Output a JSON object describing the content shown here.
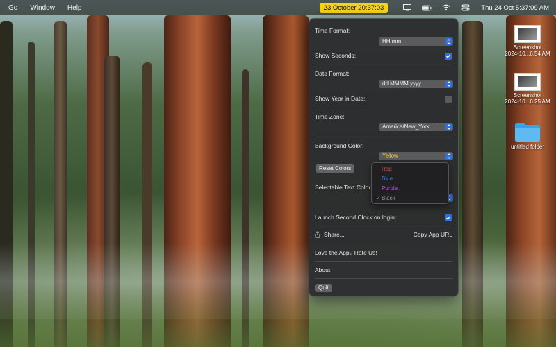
{
  "menubar": {
    "menus": [
      "Go",
      "Window",
      "Help"
    ],
    "clock_badge": "23 October  20:37:03",
    "icons": [
      "display-icon",
      "battery-icon",
      "wifi-icon",
      "control-center-icon"
    ],
    "datetime": "Thu 24 Oct  5:37:09 AM",
    "accent": "#f5d21a"
  },
  "panel": {
    "time_format_label": "Time Format:",
    "time_format_value": "HH:mm",
    "show_seconds_label": "Show Seconds:",
    "show_seconds_checked": true,
    "date_format_label": "Date Format:",
    "date_format_value": "dd MMMM yyyy",
    "show_year_label": "Show Year in Date:",
    "show_year_checked": false,
    "time_zone_label": "Time Zone:",
    "time_zone_value": "America/New_York",
    "bg_color_label": "Background Color:",
    "bg_color_value": "Yellow",
    "bg_color_value_color": "#f5d21a",
    "reset_colors": "Reset Colors",
    "selectable_text_color_label": "Selectable Text Color",
    "launch_login_label": "Launch Second Clock on login:",
    "launch_login_checked": true,
    "share_label": "Share...",
    "copy_url_label": "Copy App URL",
    "rate_label": "Love the App? Rate Us!",
    "about_label": "About",
    "quit_label": "Quit",
    "checkbox_color": "#2f6fe0"
  },
  "popup": {
    "options": [
      {
        "label": "Red",
        "color": "#e0524a",
        "selected": false
      },
      {
        "label": "Blue",
        "color": "#3d7ef0",
        "selected": false
      },
      {
        "label": "Purple",
        "color": "#b55ae0",
        "selected": false
      },
      {
        "label": "Black",
        "color": "#9a9a9a",
        "selected": true
      }
    ],
    "check_mark": "✓"
  },
  "desktop": {
    "items": [
      {
        "name": "Screenshot",
        "sub": "2024-10...6.54 AM",
        "kind": "image"
      },
      {
        "name": "Screenshot",
        "sub": "2024-10...6.25 AM",
        "kind": "image"
      },
      {
        "name": "untitled folder",
        "kind": "folder"
      }
    ]
  }
}
